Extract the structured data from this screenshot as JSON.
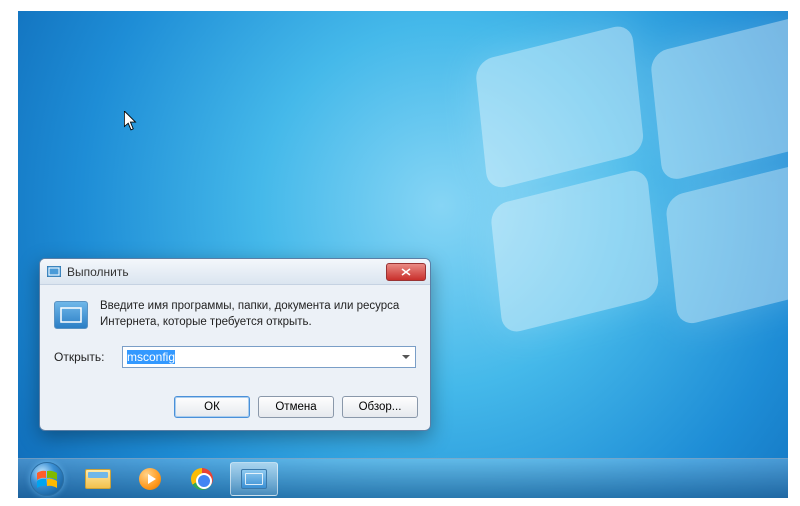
{
  "dialog": {
    "title": "Выполнить",
    "description": "Введите имя программы, папки, документа или ресурса Интернета, которые требуется открыть.",
    "open_label": "Открыть:",
    "input_value": "msconfig",
    "ok_label": "ОК",
    "cancel_label": "Отмена",
    "browse_label": "Обзор..."
  },
  "taskbar": {
    "start": "Пуск",
    "items": [
      {
        "name": "explorer"
      },
      {
        "name": "media-player"
      },
      {
        "name": "chrome"
      },
      {
        "name": "run",
        "active": true
      }
    ]
  }
}
